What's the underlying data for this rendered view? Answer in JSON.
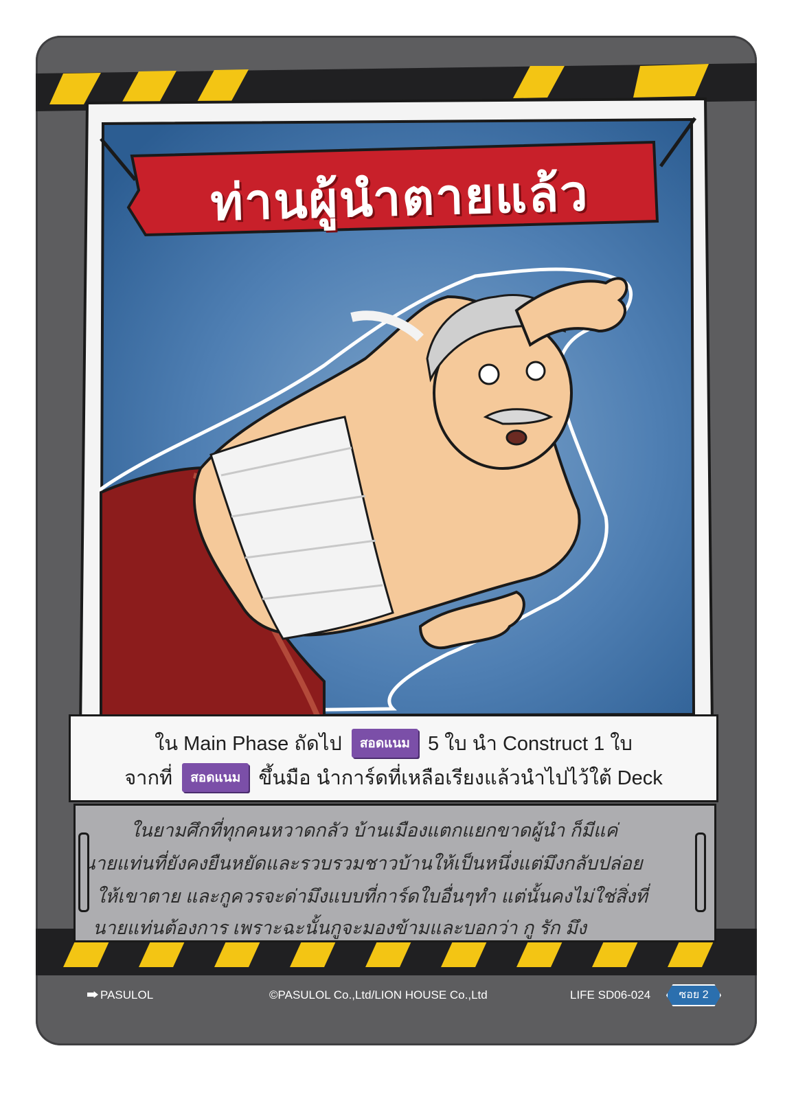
{
  "card": {
    "title": "ท่านผู้นำตายแล้ว",
    "effect": {
      "line1_a": "ใน Main Phase ถัดไป",
      "keyword1": "สอดแนม",
      "line1_b": "5 ใบ นำ Construct 1 ใบ",
      "line2_a": "จากที่",
      "keyword2": "สอดแนม",
      "line2_b": "ขึ้นมือ นำการ์ดที่เหลือเรียงแล้วนำไปไว้ใต้ Deck"
    },
    "flavor": [
      "ในยามศึกที่ทุกคนหวาดกลัว บ้านเมืองแตกแยกขาดผู้นำ ก็มีแค่",
      "นายแท่นที่ยังคงยืนหยัดและรวบรวมชาวบ้านให้เป็นหนึ่งแต่มึงกลับปล่อย",
      "ให้เขาตาย และกูควรจะด่ามึงแบบที่การ์ดใบอื่นๆทำ แต่นั้นคงไม่ใช่สิ่งที่",
      "นายแท่นต้องการ เพราะฉะนั้นกูจะมองข้ามและบอกว่า กู รัก มึง"
    ],
    "footer": {
      "brand": "PASULOL",
      "copyright": "©PASULOL Co.,Ltd/LION HOUSE Co.,Ltd",
      "code": "LIFE SD06-024",
      "set": "ซอย 2"
    },
    "colors": {
      "frame": "#5d5d5f",
      "banner": "#c8202a",
      "sky": "#3f6fa3",
      "keyword": "#7b4fa8",
      "hazard_yellow": "#f3c514",
      "badge": "#2b6fae"
    },
    "illustration": "bald-old-man-with-white-bandage-and-red-pants"
  }
}
